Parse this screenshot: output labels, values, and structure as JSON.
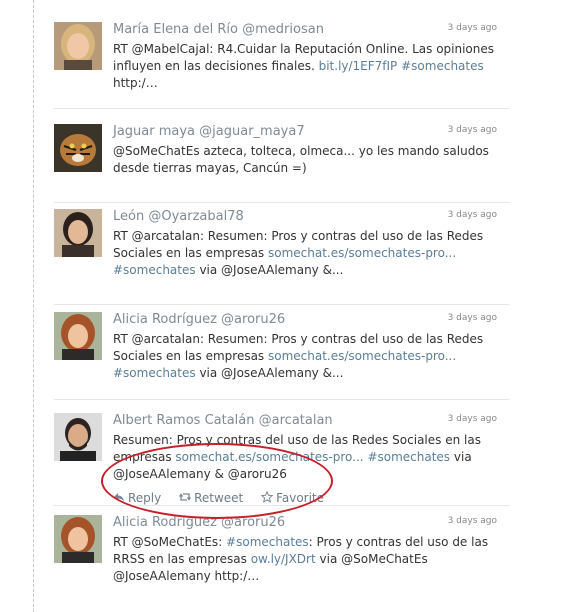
{
  "tweets": [
    {
      "name": "María Elena del Río",
      "handle": "@medriosan",
      "time": "3 days ago",
      "avatar": "woman-blonde-avatar",
      "parts": [
        {
          "t": "RT "
        },
        {
          "t": "@MabelCajal",
          "k": "mention"
        },
        {
          "t": ": R4.Cuidar la Reputación Online. Las opiniones influyen en las decisiones finales. "
        },
        {
          "t": "bit.ly/1EF7fIP",
          "k": "link"
        },
        {
          "t": " "
        },
        {
          "t": "#somechates",
          "k": "tag"
        },
        {
          "t": " http:/…"
        }
      ]
    },
    {
      "name": "Jaguar maya",
      "handle": "@jaguar_maya7",
      "time": "3 days ago",
      "avatar": "tiger-avatar",
      "parts": [
        {
          "t": "@SoMeChatEs",
          "k": "mention"
        },
        {
          "t": " azteca, tolteca, olmeca... yo les mando saludos desde tierras mayas, Cancún =)"
        }
      ]
    },
    {
      "name": "León",
      "handle": "@Oyarzabal78",
      "time": "3 days ago",
      "avatar": "woman-dark-hair-avatar",
      "parts": [
        {
          "t": "RT "
        },
        {
          "t": "@arcatalan",
          "k": "mention"
        },
        {
          "t": ": Resumen: Pros y contras del uso de las Redes Sociales en las empresas "
        },
        {
          "t": "somechat.es/somechates-pro...",
          "k": "link"
        },
        {
          "t": " "
        },
        {
          "t": "#somechates",
          "k": "tag"
        },
        {
          "t": " via "
        },
        {
          "t": "@JoseAAlemany",
          "k": "mention"
        },
        {
          "t": " &..."
        }
      ]
    },
    {
      "name": "Alicia Rodríguez",
      "handle": "@aroru26",
      "time": "3 days ago",
      "avatar": "woman-red-hair-avatar",
      "parts": [
        {
          "t": "RT "
        },
        {
          "t": "@arcatalan",
          "k": "mention"
        },
        {
          "t": ": Resumen: Pros y contras del uso de las Redes Sociales en las empresas "
        },
        {
          "t": "somechat.es/somechates-pro...",
          "k": "link"
        },
        {
          "t": " "
        },
        {
          "t": "#somechates",
          "k": "tag"
        },
        {
          "t": " via "
        },
        {
          "t": "@JoseAAlemany",
          "k": "mention"
        },
        {
          "t": " &..."
        }
      ]
    },
    {
      "name": "Albert Ramos Catalán",
      "handle": "@arcatalan",
      "time": "3 days ago",
      "avatar": "man-beard-avatar",
      "parts": [
        {
          "t": "Resumen: Pros y contras del uso de las Redes Sociales en las empresas "
        },
        {
          "t": "somechat.es/somechates-pro...",
          "k": "link"
        },
        {
          "t": " "
        },
        {
          "t": "#somechates",
          "k": "tag"
        },
        {
          "t": " via "
        },
        {
          "t": "@JoseAAlemany",
          "k": "mention"
        },
        {
          "t": " & "
        },
        {
          "t": "@aroru26",
          "k": "mention"
        }
      ],
      "actions": [
        {
          "label": "Reply",
          "icon": "reply-icon"
        },
        {
          "label": "Retweet",
          "icon": "retweet-icon"
        },
        {
          "label": "Favorite",
          "icon": "star-icon"
        }
      ]
    },
    {
      "name": "Alicia Rodríguez",
      "handle": "@aroru26",
      "time": "3 days ago",
      "avatar": "woman-red-hair-avatar",
      "parts": [
        {
          "t": "RT "
        },
        {
          "t": "@SoMeChatEs",
          "k": "mention"
        },
        {
          "t": ": "
        },
        {
          "t": "#somechates",
          "k": "tag"
        },
        {
          "t": ": Pros y contras del uso de las RRSS en las empresas "
        },
        {
          "t": "ow.ly/JXDrt",
          "k": "link"
        },
        {
          "t": " via "
        },
        {
          "t": "@SoMeChatEs",
          "k": "mention"
        },
        {
          "t": " "
        },
        {
          "t": "@JoseAAlemany",
          "k": "mention"
        },
        {
          "t": " http:/…"
        }
      ]
    }
  ],
  "colors": {
    "link": "#5a7e98",
    "name": "#7f8a94",
    "highlight_ellipse": "#c4202a"
  }
}
